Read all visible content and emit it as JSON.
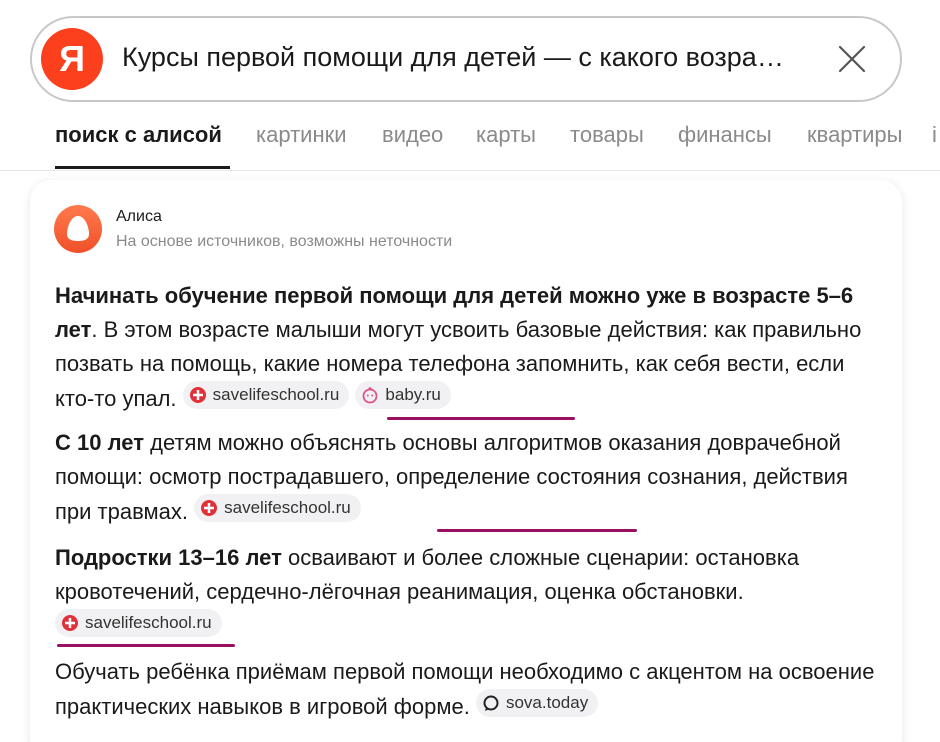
{
  "search": {
    "logo_letter": "Я",
    "query": "Курсы первой помощи для детей — с какого возра…"
  },
  "tabs": [
    {
      "label": "поиск с алисой",
      "active": true
    },
    {
      "label": "картинки"
    },
    {
      "label": "видео"
    },
    {
      "label": "карты"
    },
    {
      "label": "товары"
    },
    {
      "label": "финансы"
    },
    {
      "label": "квартиры"
    },
    {
      "label": "і"
    }
  ],
  "alisa": {
    "name": "Алиса",
    "note": "На основе источников, возможны неточности"
  },
  "answer": [
    {
      "bold": "Начинать обучение первой помощи для детей можно уже в возрасте 5–6 лет",
      "text": ". В этом возрасте малыши могут усвоить базовые действия: как правильно позвать на помощь, какие номера телефона запомнить, как себя вести, если кто-то упал.",
      "sources": [
        "savelifeschool.ru",
        "baby.ru"
      ]
    },
    {
      "bold": "С 10 лет",
      "text": " детям можно объяснять основы алгоритмов оказания доврачебной помощи: осмотр пострадавшего, определение состояния сознания, действия при травмах.",
      "sources": [
        "savelifeschool.ru"
      ]
    },
    {
      "bold": "Подростки 13–16 лет",
      "text": " осваивают и более сложные сценарии: остановка кровотечений, сердечно-лёгочная реанимация, оценка обстановки.",
      "sources": [
        "savelifeschool.ru"
      ]
    },
    {
      "bold": "",
      "text": "Обучать ребёнка приёмам первой помощи необходимо с акцентом на освоение практических навыков в игровой форме.",
      "sources": [
        "sova.today"
      ]
    }
  ],
  "colors": {
    "brand": "#fc3f1d",
    "annotation": "#9a1060"
  }
}
